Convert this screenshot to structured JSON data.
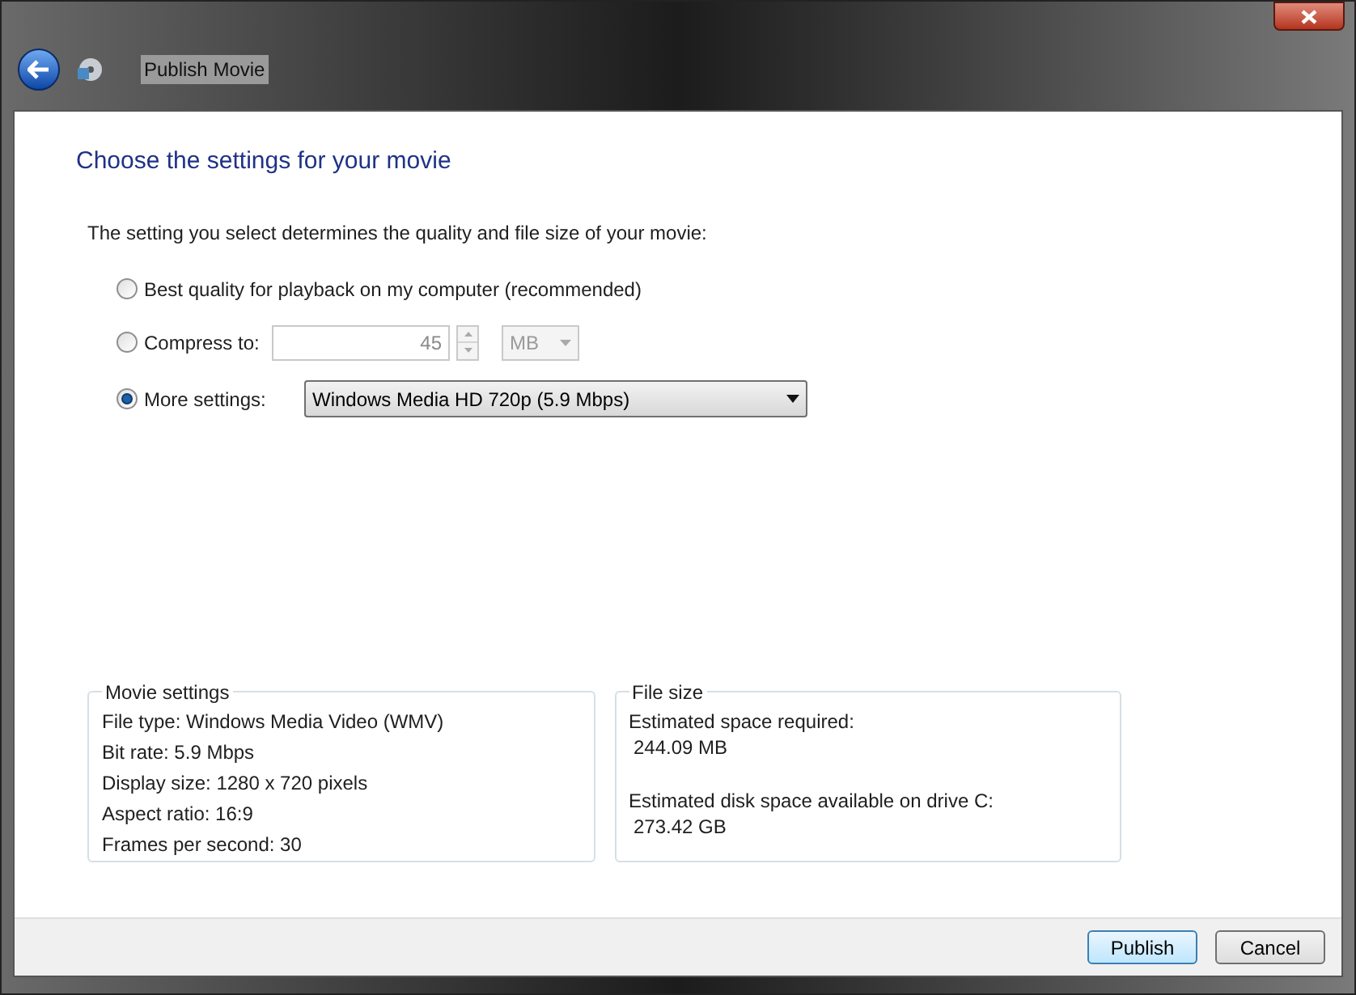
{
  "window": {
    "title": "Publish Movie"
  },
  "heading": "Choose the settings for your movie",
  "intro": "The setting you select determines the quality and file size of your movie:",
  "options": [
    {
      "kind": "plain",
      "label": "Best quality for playback on my computer (recommended)",
      "selected": false
    },
    {
      "kind": "compress",
      "label": "Compress to:",
      "selected": false,
      "value": "45",
      "unit": "MB",
      "disabled": true
    },
    {
      "kind": "dropdown",
      "label": "More settings:",
      "selected": true,
      "value": "Windows Media HD 720p (5.9 Mbps)"
    }
  ],
  "movie_settings": {
    "title": "Movie settings",
    "lines": [
      "File type: Windows Media Video (WMV)",
      "Bit rate: 5.9 Mbps",
      "Display size: 1280 x 720 pixels",
      "Aspect ratio: 16:9",
      "Frames per second: 30"
    ]
  },
  "file_size": {
    "title": "File size",
    "items": [
      {
        "label": "Estimated space required:",
        "value": "244.09 MB"
      },
      {
        "label": "Estimated disk space available on drive C:",
        "value": "273.42 GB"
      }
    ]
  },
  "buttons": [
    {
      "label": "Publish",
      "default": true
    },
    {
      "label": "Cancel",
      "default": false
    }
  ]
}
